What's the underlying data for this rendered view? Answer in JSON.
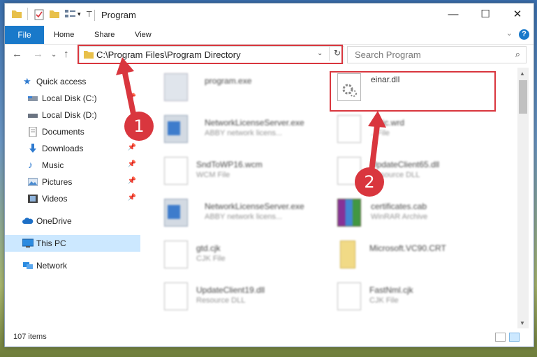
{
  "window": {
    "title": "Program",
    "controls": {
      "minimize": "—",
      "maximize": "☐",
      "close": "✕"
    }
  },
  "ribbon": {
    "file_tab": "File",
    "tabs": [
      "Home",
      "Share",
      "View"
    ]
  },
  "address": {
    "path": "C:\\Program Files\\Program Directory",
    "search_placeholder": "Search Program"
  },
  "sidebar": {
    "items": [
      {
        "label": "Quick access",
        "icon": "star-icon"
      },
      {
        "label": "Local Disk (C:)",
        "icon": "drive-icon"
      },
      {
        "label": "Local Disk (D:)",
        "icon": "drive-icon"
      },
      {
        "label": "Documents",
        "icon": "documents-icon"
      },
      {
        "label": "Downloads",
        "icon": "download-icon"
      },
      {
        "label": "Music",
        "icon": "music-icon"
      },
      {
        "label": "Pictures",
        "icon": "pictures-icon"
      },
      {
        "label": "Videos",
        "icon": "videos-icon"
      },
      {
        "label": "OneDrive",
        "icon": "cloud-icon"
      },
      {
        "label": "This PC",
        "icon": "computer-icon"
      },
      {
        "label": "Network",
        "icon": "network-icon"
      }
    ]
  },
  "files": [
    {
      "name": "program.exe",
      "type": "",
      "kind": "exe"
    },
    {
      "name": "einar.dll",
      "type": "",
      "kind": "dll"
    },
    {
      "name": "NetworkLicenseServer.exe",
      "type": "ABBY network licens...",
      "kind": "app"
    },
    {
      "name": "...pic.wrd",
      "type": "...File",
      "kind": "doc"
    },
    {
      "name": "SndToWP16.wcm",
      "type": "WCM File",
      "kind": "doc"
    },
    {
      "name": "UpdateClient65.dll",
      "type": "Resource DLL",
      "kind": "dll"
    },
    {
      "name": "NetworkLicenseServer.exe",
      "type": "ABBY network licens...",
      "kind": "app"
    },
    {
      "name": "certificates.cab",
      "type": "WinRAR Archive",
      "kind": "rar"
    },
    {
      "name": "gtd.cjk",
      "type": "CJK File",
      "kind": "doc"
    },
    {
      "name": "Microsoft.VC90.CRT",
      "type": "",
      "kind": "folder"
    },
    {
      "name": "UpdateClient19.dll",
      "type": "Resource DLL",
      "kind": "dll"
    },
    {
      "name": "FastNml.cjk",
      "type": "CJK File",
      "kind": "doc"
    }
  ],
  "status": {
    "count": "107 items"
  },
  "annotations": {
    "step1": "1",
    "step2": "2",
    "color": "#d9363e"
  }
}
